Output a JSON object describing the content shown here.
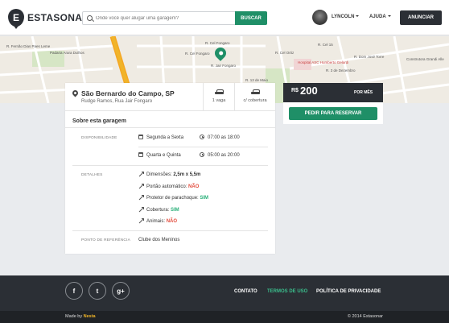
{
  "header": {
    "logo_letter": "E",
    "logo_text_1": "ESTA",
    "logo_text_2": "SONAR",
    "search_placeholder": "Onde você quer alugar uma garagem?",
    "search_button": "BUSCAR",
    "user_name": "LYNCOLN",
    "help_label": "AJUDA",
    "announce_button": "ANUNCIAR"
  },
  "map": {
    "labels": [
      "R. Fernão Dias Paes Leme",
      "Padaria Arara Dulhos",
      "R. Cel Fongaro",
      "R. Cel Fongaro",
      "R. Jair Fongaro",
      "R. 13 de Maio",
      "R. Cel Ortiz",
      "Hospital ASC Humberto Gelardi",
      "R. 3 de Dezembro",
      "R. Dom José Torre",
      "Construtora Grandi Alle",
      "R. Cel 15"
    ]
  },
  "garage": {
    "city": "São Bernardo do Campo, SP",
    "street": "Rudge Ramos, Rua Jair Fongaro",
    "feature_1": "1 vaga",
    "feature_2": "c/ cobertura",
    "about_title": "Sobre esta garagem",
    "availability_label": "DISPONIBILIDADE",
    "availability": [
      {
        "days": "Segunda a Sexta",
        "hours": "07:00 as 18:00"
      },
      {
        "days": "Quarta e Quinta",
        "hours": "05:00 as 20:00"
      }
    ],
    "details_label": "DETALHES",
    "details": [
      {
        "key": "Dimensões: ",
        "value": "2,5m x 5,5m",
        "state": "plain"
      },
      {
        "key": "Portão automático: ",
        "value": "NÃO",
        "state": "no"
      },
      {
        "key": "Protetor de parachoque: ",
        "value": "SIM",
        "state": "yes"
      },
      {
        "key": "Cobertura: ",
        "value": "SIM",
        "state": "yes"
      },
      {
        "key": "Animais: ",
        "value": "NÃO",
        "state": "no"
      }
    ],
    "reference_label": "PONTO DE REFERÊNCIA",
    "reference": "Clube dos Meninos"
  },
  "price": {
    "currency": "R$",
    "amount": "200",
    "period": "POR MÊS",
    "reserve_button": "PEDIR PARA RESERVAR"
  },
  "footer": {
    "social": [
      "f",
      "t",
      "g+"
    ],
    "links": [
      "CONTATO",
      "TERMOS DE USO",
      "POLÍTICA DE PRIVACIDADE"
    ],
    "active_link": "TERMOS DE USO",
    "made_by": "Made by ",
    "made_by_brand": "Nesta",
    "copyright": "© 2014 Estasonar"
  },
  "colors": {
    "brand_green": "#1f8f67",
    "dark": "#2b2f35",
    "yes": "#2bb07a",
    "no": "#e24a3b",
    "accent_link": "#3bbf8d",
    "made_by_brand": "#f0b428"
  }
}
